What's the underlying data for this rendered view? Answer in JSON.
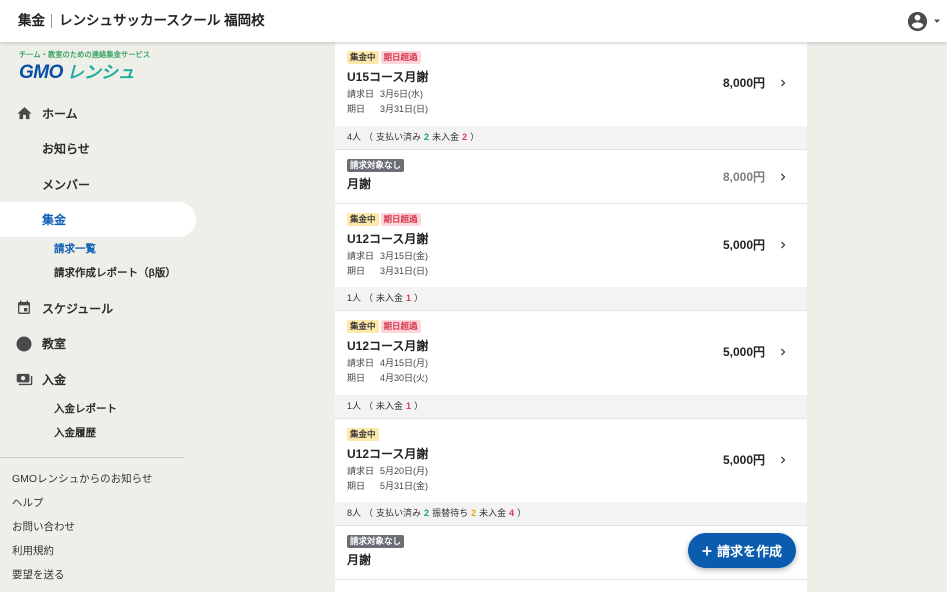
{
  "header": {
    "section": "集金",
    "school": "レンシュサッカースクール 福岡校",
    "avatar_icon": "account-circle-icon",
    "menu_icon": "caret-down-icon"
  },
  "logo": {
    "tagline": "チーム・教室のための連絡集金サービス",
    "brand_gmo": "GMO",
    "brand_name": "レンシュ"
  },
  "nav": [
    {
      "label": "ホーム",
      "icon": "home-icon"
    },
    {
      "label": "お知らせ"
    },
    {
      "label": "メンバー"
    },
    {
      "label": "集金",
      "active": true,
      "subitems": [
        {
          "label": "請求一覧",
          "active": true
        },
        {
          "label": "請求作成レポート（β版）"
        }
      ]
    },
    {
      "label": "スケジュール",
      "icon": "calendar-icon"
    },
    {
      "label": "教室",
      "icon": "circle-icon"
    },
    {
      "label": "入金",
      "icon": "payments-icon",
      "subitems": [
        {
          "label": "入金レポート"
        },
        {
          "label": "入金履歴"
        }
      ]
    }
  ],
  "footer_links": [
    "GMOレンシュからのお知らせ",
    "ヘルプ",
    "お問い合わせ",
    "利用規約",
    "要望を送る"
  ],
  "list": {
    "billing_label": "請求日",
    "due_label": "期日",
    "summary_open": "（",
    "summary_close": "）",
    "row_icon": "chevron-right-icon"
  },
  "invoices": [
    {
      "badges": [
        {
          "text": "集金中",
          "bg": "#fce8a8",
          "fg": "#3c3c3c"
        },
        {
          "text": "期日超過",
          "bg": "#fbd7dc",
          "fg": "#d8354d"
        }
      ],
      "title": "U15コース月謝",
      "billing_date": "3月6日(水)",
      "due_date": "3月31日(日)",
      "amount": "8,000円",
      "amount_color": "#222222",
      "summary": {
        "count": "4人",
        "parts": [
          {
            "label": "支払い済み",
            "value": "2",
            "color": "#159d8b"
          },
          {
            "label": "未入金",
            "value": "2",
            "color": "#e2394f"
          }
        ]
      }
    },
    {
      "badges": [
        {
          "text": "請求対象なし",
          "bg": "#6b6f75",
          "fg": "#ffffff"
        }
      ],
      "title": "月謝",
      "amount": "8,000円",
      "amount_color": "#7a7e84"
    },
    {
      "badges": [
        {
          "text": "集金中",
          "bg": "#fce8a8",
          "fg": "#3c3c3c"
        },
        {
          "text": "期日超過",
          "bg": "#fbd7dc",
          "fg": "#d8354d"
        }
      ],
      "title": "U12コース月謝",
      "billing_date": "3月15日(金)",
      "due_date": "3月31日(日)",
      "amount": "5,000円",
      "amount_color": "#222222",
      "summary": {
        "count": "1人",
        "parts": [
          {
            "label": "未入金",
            "value": "1",
            "color": "#e2394f"
          }
        ]
      }
    },
    {
      "badges": [
        {
          "text": "集金中",
          "bg": "#fce8a8",
          "fg": "#3c3c3c"
        },
        {
          "text": "期日超過",
          "bg": "#fbd7dc",
          "fg": "#d8354d"
        }
      ],
      "title": "U12コース月謝",
      "billing_date": "4月15日(月)",
      "due_date": "4月30日(火)",
      "amount": "5,000円",
      "amount_color": "#222222",
      "summary": {
        "count": "1人",
        "parts": [
          {
            "label": "未入金",
            "value": "1",
            "color": "#e2394f"
          }
        ]
      }
    },
    {
      "badges": [
        {
          "text": "集金中",
          "bg": "#fce8a8",
          "fg": "#3c3c3c"
        }
      ],
      "title": "U12コース月謝",
      "billing_date": "5月20日(月)",
      "due_date": "5月31日(金)",
      "amount": "5,000円",
      "amount_color": "#222222",
      "summary": {
        "count": "8人",
        "parts": [
          {
            "label": "支払い済み",
            "value": "2",
            "color": "#159d8b"
          },
          {
            "label": "振替待ち",
            "value": "2",
            "color": "#e3a514"
          },
          {
            "label": "未入金",
            "value": "4",
            "color": "#e2394f"
          }
        ]
      }
    },
    {
      "badges": [
        {
          "text": "請求対象なし",
          "bg": "#6b6f75",
          "fg": "#ffffff"
        }
      ],
      "title": "月謝"
    }
  ],
  "fab": {
    "icon": "plus-icon",
    "label": "請求を作成"
  },
  "colors": {
    "accent": "#0d5fb5",
    "background": "#efefea",
    "summary_background": "#f3f3f3",
    "fab": "#0b5cae"
  }
}
